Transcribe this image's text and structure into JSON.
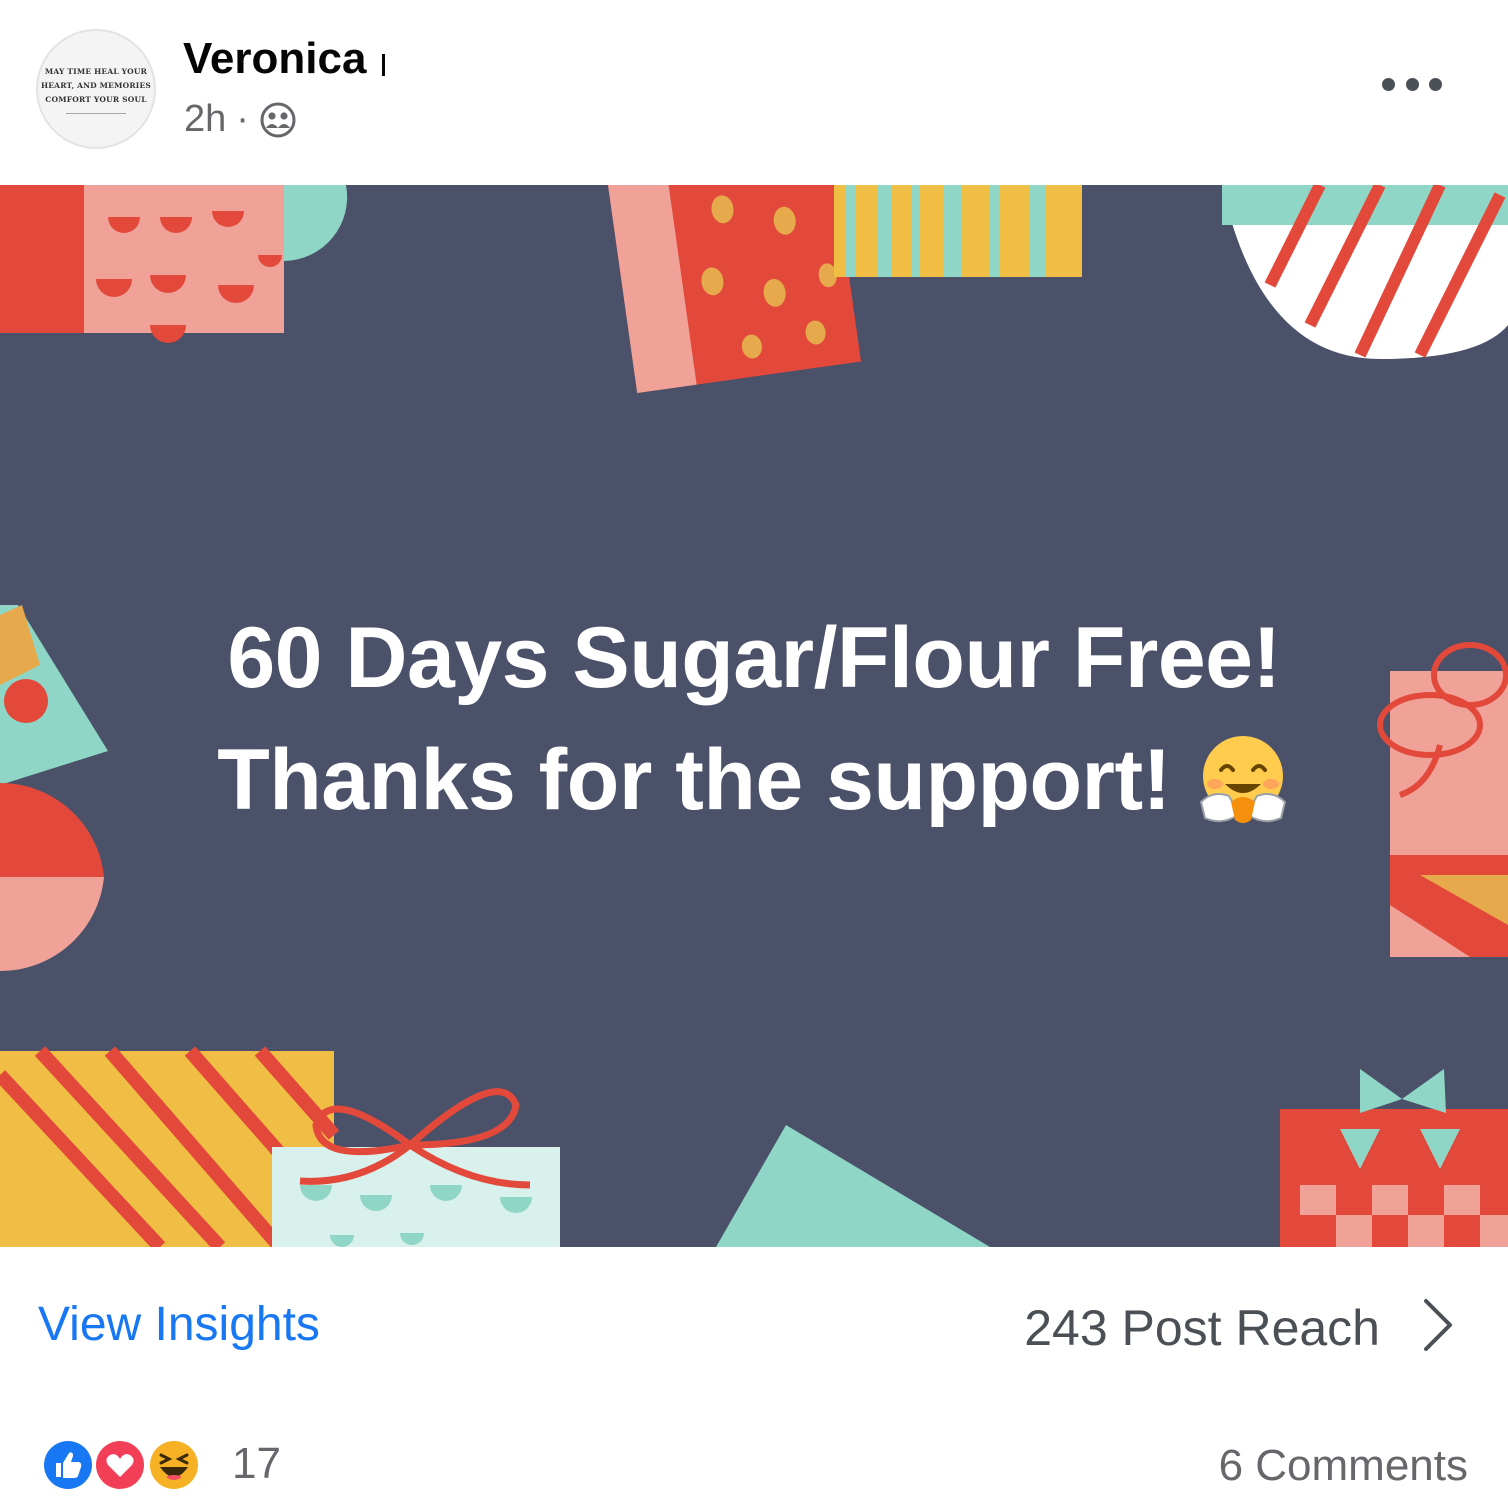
{
  "post": {
    "author_name": "Veronica",
    "timestamp": "2h",
    "separator": "·",
    "audience_icon": "friends-icon",
    "more_icon": "more-options-icon",
    "avatar_text": {
      "line1": "MAY TIME HEAL YOUR",
      "line2": "HEART, AND MEMORIES",
      "line3": "COMFORT YOUR SOUL"
    }
  },
  "image": {
    "text_line1": "60 Days Sugar/Flour Free!",
    "text_line2": "Thanks for the support!",
    "emoji": "hugging-face-emoji",
    "background_color": "#4a5169"
  },
  "insights": {
    "label": "View Insights",
    "reach": "243 Post Reach",
    "chevron_icon": "chevron-right-icon"
  },
  "reactions": {
    "icons": [
      "like-icon",
      "love-icon",
      "haha-icon"
    ],
    "count": "17",
    "comments": "6 Comments"
  },
  "colors": {
    "accent": "#1877f2",
    "text_primary": "#050505",
    "text_secondary": "#65676b"
  }
}
